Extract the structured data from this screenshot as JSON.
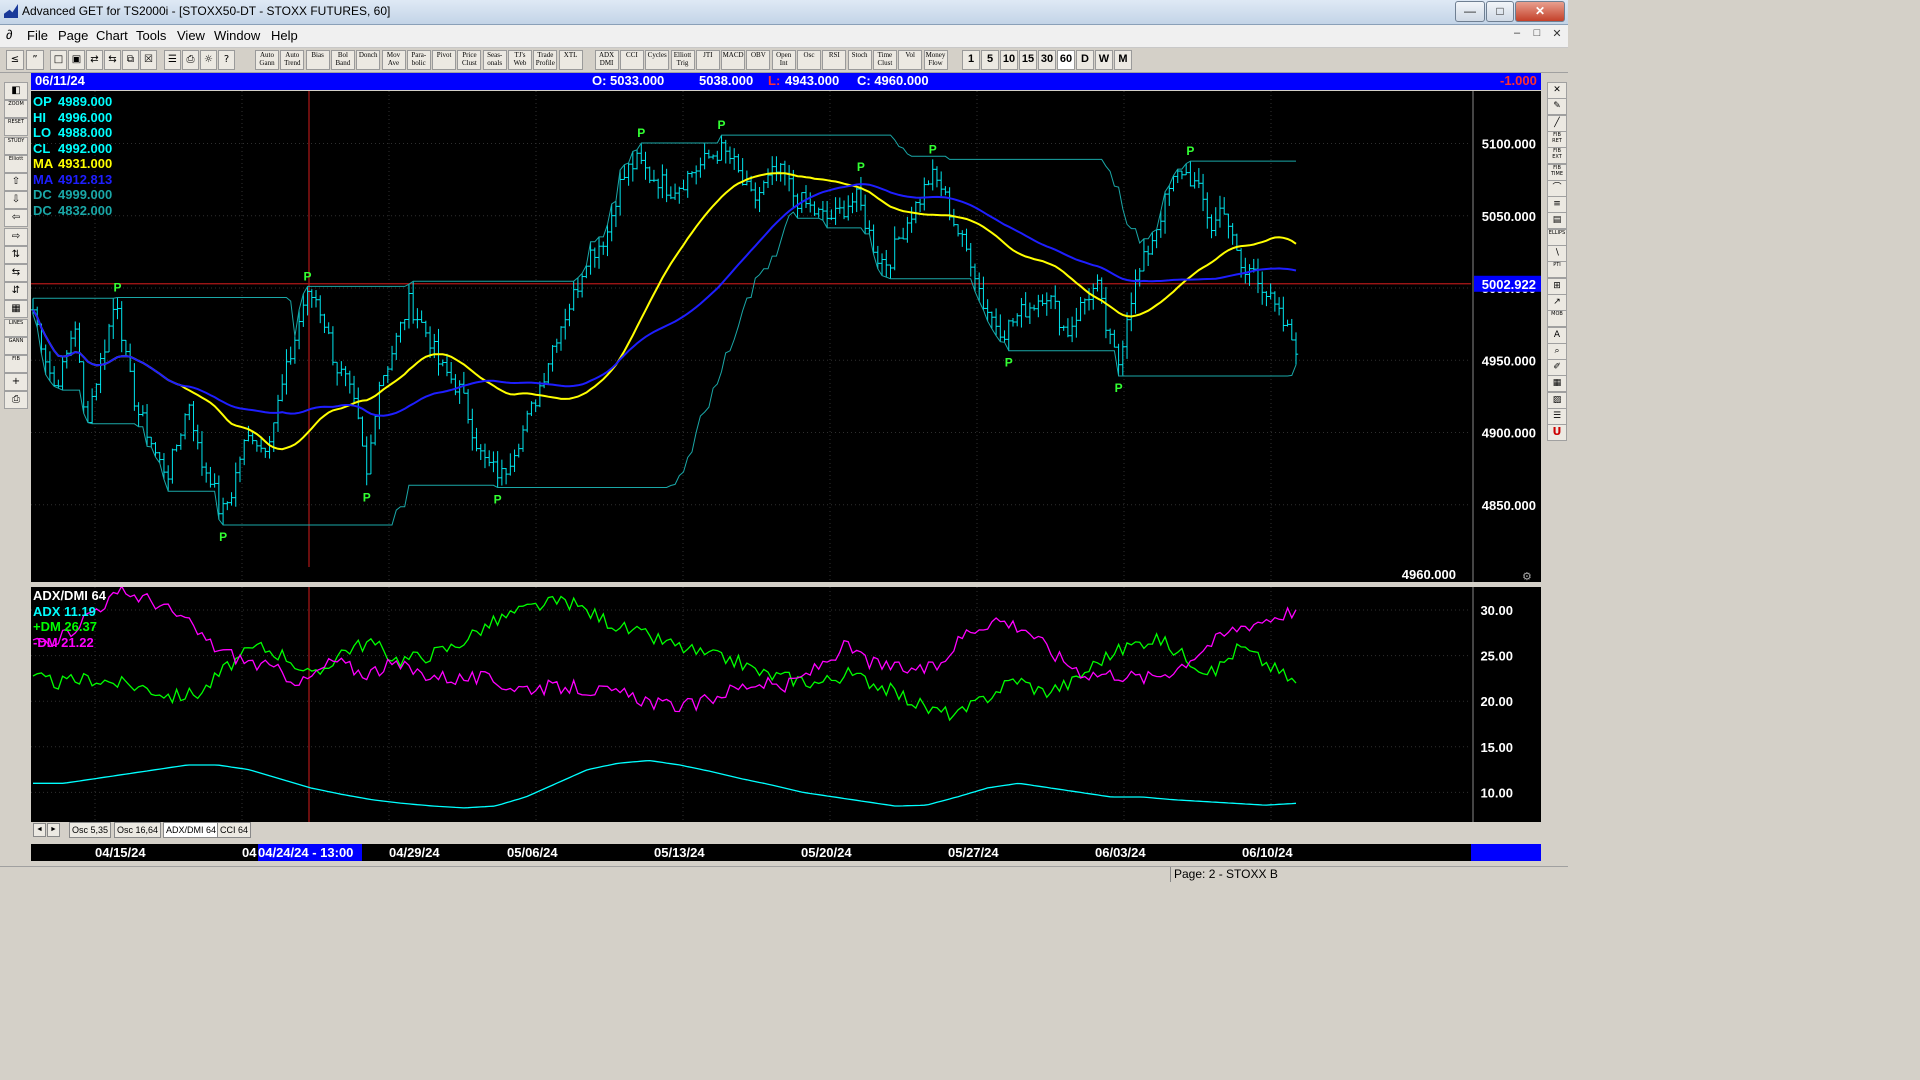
{
  "window": {
    "title": "Advanced GET for TS2000i - [STOXX50-DT - STOXX FUTURES, 60]",
    "min_glyph": "—",
    "max_glyph": "□",
    "close_glyph": "✕"
  },
  "menu": {
    "items": [
      "File",
      "Page",
      "Chart",
      "Tools",
      "View",
      "Window",
      "Help"
    ],
    "mdi": [
      "–",
      "□",
      "✕"
    ]
  },
  "toolbar": {
    "leading_icons": [
      "≤",
      "”"
    ],
    "file_icons": [
      "□",
      "▣",
      "⇄",
      "⇆",
      "⧉",
      "☒",
      "☰",
      "⎙",
      "☼",
      "?"
    ],
    "study_buttons": [
      {
        "label": "Auto Gann"
      },
      {
        "label": "Auto Trend"
      },
      {
        "label": "Bias"
      },
      {
        "label": "Bol Band"
      },
      {
        "label": "Donch"
      },
      {
        "label": "Mov Ave"
      },
      {
        "label": "Para- bolic"
      },
      {
        "label": "Pivot"
      },
      {
        "label": "Price Clust"
      },
      {
        "label": "Seas- onals"
      },
      {
        "label": "TJ's Web"
      },
      {
        "label": "Trade Profile"
      },
      {
        "label": "XTL"
      },
      {
        "label": "ADX DMI"
      },
      {
        "label": "CCI"
      },
      {
        "label": "Cycles"
      },
      {
        "label": "Elliott Trig"
      },
      {
        "label": "JTI"
      },
      {
        "label": "MACD"
      },
      {
        "label": "OBV"
      },
      {
        "label": "Open Int"
      },
      {
        "label": "Osc"
      },
      {
        "label": "RSI"
      },
      {
        "label": "Stoch"
      },
      {
        "label": "Time Clust"
      },
      {
        "label": "Vol"
      },
      {
        "label": "Money Flow"
      }
    ],
    "periods": [
      "1",
      "5",
      "10",
      "15",
      "30",
      "60",
      "D",
      "W",
      "M"
    ]
  },
  "left_toolbar": [
    {
      "label": "◧",
      "name": "open-icon"
    },
    {
      "label": "ZOOM",
      "name": "zoom-icon",
      "small": true
    },
    {
      "label": "RESET",
      "name": "reset-icon",
      "small": true
    },
    {
      "label": "STUDY",
      "name": "study-icon",
      "small": true
    },
    {
      "label": "Elliott",
      "name": "elliott-icon",
      "small": true
    },
    {
      "label": "⇧",
      "name": "arrow-up-icon"
    },
    {
      "label": "⇩",
      "name": "arrow-down-icon"
    },
    {
      "label": "⇦",
      "name": "arrow-left-icon"
    },
    {
      "label": "⇨",
      "name": "arrow-right-icon"
    },
    {
      "label": "⇅",
      "name": "expand-vertical-icon"
    },
    {
      "label": "⇆",
      "name": "expand-horizontal-icon"
    },
    {
      "label": "⇵",
      "name": "compress-vertical-icon"
    },
    {
      "label": "▦",
      "name": "grid-icon"
    },
    {
      "label": "LINES",
      "name": "lines-icon",
      "small": true
    },
    {
      "label": "GANN",
      "name": "gann-icon",
      "small": true
    },
    {
      "label": "FIB",
      "name": "fib-icon",
      "small": true
    },
    {
      "label": "+",
      "name": "crosshair-icon"
    },
    {
      "label": "⎙",
      "name": "print-icon"
    }
  ],
  "right_toolbar": [
    {
      "label": "✕",
      "name": "close-tool-icon"
    },
    {
      "label": "✎",
      "name": "pencil-icon"
    },
    {
      "label": "╱",
      "name": "trendline-icon"
    },
    {
      "label": "FIB RET",
      "name": "fib-retracement-icon",
      "small": true
    },
    {
      "label": "FIB EXT",
      "name": "fib-extension-icon",
      "small": true
    },
    {
      "label": "FIB TIME",
      "name": "fib-time-icon",
      "small": true
    },
    {
      "label": "⌒",
      "name": "arc-icon"
    },
    {
      "label": "≡",
      "name": "channel-icon"
    },
    {
      "label": "▤",
      "name": "box-icon"
    },
    {
      "label": "ELLIPS",
      "name": "ellipse-icon",
      "small": true
    },
    {
      "label": "∖",
      "name": "fan-icon"
    },
    {
      "label": "PTI",
      "name": "pti-icon",
      "small": true
    },
    {
      "label": "⊞",
      "name": "gann-box-icon"
    },
    {
      "label": "↗",
      "name": "regression-icon"
    },
    {
      "label": "MOB",
      "name": "mob-icon",
      "small": true
    },
    {
      "label": "A",
      "name": "text-icon"
    },
    {
      "label": "⌕",
      "name": "magnifier-icon"
    },
    {
      "label": "✐",
      "name": "erase-icon"
    },
    {
      "label": "▦",
      "name": "template-icon"
    },
    {
      "label": "▨",
      "name": "layers-icon"
    },
    {
      "label": "☰",
      "name": "list-icon"
    },
    {
      "label": "U",
      "name": "magnet-icon",
      "red": true
    }
  ],
  "info_bar": {
    "date": "06/11/24",
    "open": "O: 5033.000",
    "high": "5038.000",
    "low_label": "L:",
    "low": "4943.000",
    "close": "C: 4960.000",
    "change": "-1.000"
  },
  "price_legend": [
    {
      "label": "OP",
      "value": "4989.000",
      "color": "#00ffff"
    },
    {
      "label": "HI",
      "value": "4996.000",
      "color": "#00ffff"
    },
    {
      "label": "LO",
      "value": "4988.000",
      "color": "#00ffff"
    },
    {
      "label": "CL",
      "value": "4992.000",
      "color": "#00ffff"
    },
    {
      "label": "MA",
      "value": "4931.000",
      "color": "#ffff00"
    },
    {
      "label": "MA",
      "value": "4912.813",
      "color": "#1e1eff"
    },
    {
      "label": "DC",
      "value": "4999.000",
      "color": "#1aa7a7"
    },
    {
      "label": "DC",
      "value": "4832.000",
      "color": "#1aa7a7"
    }
  ],
  "price_axis": {
    "ticks": [
      "5100.000",
      "5050.000",
      "5000.000",
      "4950.000",
      "4900.000",
      "4850.000"
    ],
    "tick_values": [
      5100,
      5050,
      5000,
      4950,
      4900,
      4850
    ],
    "cursor_price": "5002.922",
    "cursor_value": 5002.922,
    "last_price": "4960.000"
  },
  "pivot_label": "P",
  "adx_legend": [
    {
      "label": "ADX/DMI 64",
      "color": "#ffffff"
    },
    {
      "label": "ADX 11.19",
      "color": "#00ffff"
    },
    {
      "label": "+DM 26.37",
      "color": "#00ff00"
    },
    {
      "label": "-DM  21.22",
      "color": "#ff00ff"
    }
  ],
  "adx_axis": {
    "ticks": [
      "30.00",
      "25.00",
      "20.00",
      "15.00",
      "10.00"
    ],
    "tick_values": [
      30,
      25,
      20,
      15,
      10
    ]
  },
  "tabs": [
    "Osc 5,35",
    "Osc 16,64",
    "ADX/DMI 64",
    "CCI 64"
  ],
  "tab_arrows": [
    "◄",
    "►"
  ],
  "date_axis": {
    "labels": [
      "04/15/24",
      "04",
      "04/29/24",
      "05/06/24",
      "05/13/24",
      "05/20/24",
      "05/27/24",
      "06/03/24",
      "06/10/24"
    ],
    "cursor_label": "04/24/24 - 13:00"
  },
  "status_bar": {
    "page": "Page: 2 - STOXX B"
  },
  "chart_data": [
    {
      "type": "candlestick",
      "title": "STOXX50-DT - STOXX FUTURES, 60",
      "ylim": [
        4820,
        5120
      ],
      "date_labels": [
        "04/15/24",
        "04/29/24",
        "05/06/24",
        "05/13/24",
        "05/20/24",
        "05/27/24",
        "06/03/24",
        "06/10/24"
      ],
      "close_path": [
        4985,
        4958,
        4932,
        4946,
        4978,
        4905,
        4935,
        4964,
        4995,
        4945,
        4915,
        4900,
        4880,
        4872,
        4898,
        4922,
        4880,
        4870,
        4842,
        4858,
        4888,
        4900,
        4888,
        4906,
        4935,
        4962,
        4992,
        4995,
        4975,
        4946,
        4935,
        4912,
        4868,
        4932,
        4948,
        4968,
        4990,
        4978,
        4965,
        4945,
        4938,
        4928,
        4905,
        4882,
        4875,
        4870,
        4888,
        4902,
        4920,
        4942,
        4965,
        4982,
        4998,
        5022,
        5028,
        5038,
        5068,
        5082,
        5088,
        5078,
        5075,
        5068,
        5072,
        5080,
        5085,
        5092,
        5095,
        5088,
        5072,
        5060,
        5070,
        5080,
        5078,
        5062,
        5058,
        5052,
        5048,
        5050,
        5058,
        5062,
        5040,
        5020,
        5018,
        5035,
        5050,
        5062,
        5078,
        5070,
        5050,
        5032,
        5018,
        4990,
        4978,
        4970,
        4978,
        4985,
        4990,
        4998,
        4985,
        4968,
        4982,
        4995,
        5000,
        4965,
        4948,
        4990,
        5010,
        5030,
        5050,
        5070,
        5082,
        5075,
        5062,
        5040,
        5060,
        5030,
        5008,
        5015,
        4998,
        4985,
        4972,
        4960
      ],
      "moving_averages": [
        {
          "name": "MA",
          "color": "#ffff00",
          "last": 4931.0
        },
        {
          "name": "MA",
          "color": "#1e1eff",
          "last": 4912.813
        }
      ],
      "donchian": {
        "upper_last": 4999.0,
        "lower_last": 4832.0
      },
      "legend": {
        "OP": 4989.0,
        "HI": 4996.0,
        "LO": 4988.0,
        "CL": 4992.0
      },
      "last_bar": {
        "open": 5033.0,
        "high": 5038.0,
        "low": 4943.0,
        "close": 4960.0,
        "change": -1.0
      },
      "cursor": {
        "date": "04/24/24 - 13:00",
        "price": 5002.922
      }
    },
    {
      "type": "line",
      "title": "ADX/DMI 64",
      "ylim": [
        6,
        31
      ],
      "series": [
        {
          "name": "ADX",
          "color": "#00ffff",
          "last": 11.19,
          "values": [
            11,
            11,
            11.5,
            12,
            12.5,
            13,
            13,
            12.5,
            11.5,
            10.5,
            9.8,
            9.2,
            8.8,
            8.5,
            8.3,
            8.5,
            9.5,
            11,
            12.5,
            13.2,
            13.5,
            13,
            12.3,
            11.5,
            10.8,
            10,
            9.5,
            9,
            8.5,
            8.6,
            9.5,
            10.5,
            11,
            10.5,
            10,
            9.5,
            9.5,
            9.2,
            9,
            8.8,
            8.6,
            8.8
          ]
        },
        {
          "name": "+DM",
          "color": "#00ff00",
          "last": 26.37,
          "values": [
            22.5,
            22,
            22.5,
            22,
            21.5,
            20.5,
            21,
            24,
            26,
            25,
            22.5,
            25.5,
            26.5,
            24.5,
            25,
            26,
            28,
            29.5,
            30.5,
            31,
            29.5,
            28,
            27,
            26,
            25,
            24.5,
            23,
            22.5,
            22,
            23,
            22,
            20.5,
            19,
            18.5,
            20.5,
            22.5,
            21,
            22,
            24.5,
            26,
            27,
            25,
            23,
            26,
            24,
            22
          ]
        },
        {
          "name": "-DM",
          "color": "#ff00ff",
          "last": 21.22,
          "values": [
            26.5,
            27,
            30,
            32,
            31,
            29,
            26,
            24.5,
            23.5,
            22,
            24.5,
            23,
            24,
            23,
            22.5,
            22.5,
            21.5,
            21.5,
            21.5,
            21,
            20.5,
            19.5,
            19.5,
            21,
            22,
            21.5,
            23.5,
            26,
            24,
            23.5,
            23.5,
            27.5,
            29,
            28,
            25,
            23,
            23,
            22.5,
            23.5,
            26,
            28,
            29,
            30
          ]
        }
      ]
    }
  ]
}
